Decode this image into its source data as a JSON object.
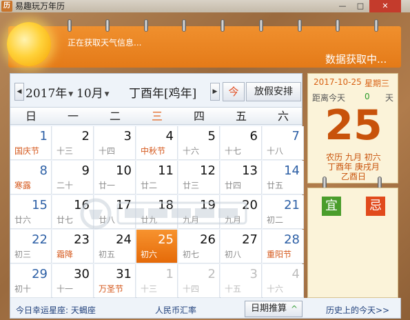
{
  "window": {
    "app_icon_glyph": "历",
    "title": "易趣玩万年历",
    "min_label": "—",
    "max_label": "□",
    "close_label": "✕"
  },
  "header": {
    "weather_status": "正在获取天气信息...",
    "data_status": "数据获取中..."
  },
  "calendar": {
    "year_label": "2017年",
    "month_label": "10月",
    "ganzhi_year": "丁酉年[鸡年]",
    "today_button": "今",
    "holiday_button": "放假安排",
    "prev_arrow": "◀",
    "next_arrow": "▶",
    "weekdays": [
      "日",
      "一",
      "二",
      "三",
      "四",
      "五",
      "六"
    ],
    "current_weekday_index": 3,
    "weeks": [
      [
        {
          "d": "1",
          "l": "国庆节",
          "fest": true
        },
        {
          "d": "2",
          "l": "十三"
        },
        {
          "d": "3",
          "l": "十四"
        },
        {
          "d": "4",
          "l": "中秋节",
          "fest": true
        },
        {
          "d": "5",
          "l": "十六"
        },
        {
          "d": "6",
          "l": "十七"
        },
        {
          "d": "7",
          "l": "十八"
        }
      ],
      [
        {
          "d": "8",
          "l": "寒露",
          "fest": true
        },
        {
          "d": "9",
          "l": "二十"
        },
        {
          "d": "10",
          "l": "廿一"
        },
        {
          "d": "11",
          "l": "廿二"
        },
        {
          "d": "12",
          "l": "廿三"
        },
        {
          "d": "13",
          "l": "廿四"
        },
        {
          "d": "14",
          "l": "廿五"
        }
      ],
      [
        {
          "d": "15",
          "l": "廿六"
        },
        {
          "d": "16",
          "l": "廿七"
        },
        {
          "d": "17",
          "l": "廿八"
        },
        {
          "d": "18",
          "l": "廿九"
        },
        {
          "d": "19",
          "l": "九月"
        },
        {
          "d": "20",
          "l": "九月"
        },
        {
          "d": "21",
          "l": "初二"
        }
      ],
      [
        {
          "d": "22",
          "l": "初三"
        },
        {
          "d": "23",
          "l": "霜降",
          "fest": true
        },
        {
          "d": "24",
          "l": "初五"
        },
        {
          "d": "25",
          "l": "初六",
          "today": true
        },
        {
          "d": "26",
          "l": "初七"
        },
        {
          "d": "27",
          "l": "初八"
        },
        {
          "d": "28",
          "l": "重阳节",
          "fest": true
        }
      ],
      [
        {
          "d": "29",
          "l": "初十"
        },
        {
          "d": "30",
          "l": "十一"
        },
        {
          "d": "31",
          "l": "万圣节",
          "fest": true
        },
        {
          "d": "1",
          "l": "十三",
          "other": true
        },
        {
          "d": "2",
          "l": "十四",
          "other": true
        },
        {
          "d": "3",
          "l": "十五",
          "other": true
        },
        {
          "d": "4",
          "l": "十六",
          "other": true
        }
      ]
    ]
  },
  "info": {
    "selected_date": "2017-10-25",
    "selected_weekday": "星期三",
    "distance_label": "距离今天",
    "distance_value": "0",
    "distance_unit": "天",
    "big_day": "25",
    "lunar_line1": "农历 九月 初六",
    "lunar_line2": "丁酉年 庚戌月",
    "lunar_line3": "乙酉日",
    "yi": "宜",
    "ji": "忌"
  },
  "footer": {
    "star_sign": "今日幸运星座: 天蝎座",
    "rmb_rate": "人民币汇率",
    "date_calc": "日期推算",
    "date_calc_chevron": "^",
    "history": "历史上的今天>>"
  },
  "colors": {
    "accent_orange": "#e47a18",
    "holiday_red": "#d5581c",
    "weekend_blue": "#2c5fa5",
    "yi_green": "#4a9d2c",
    "ji_red": "#e14a1c"
  },
  "watermark": "数码资源网"
}
